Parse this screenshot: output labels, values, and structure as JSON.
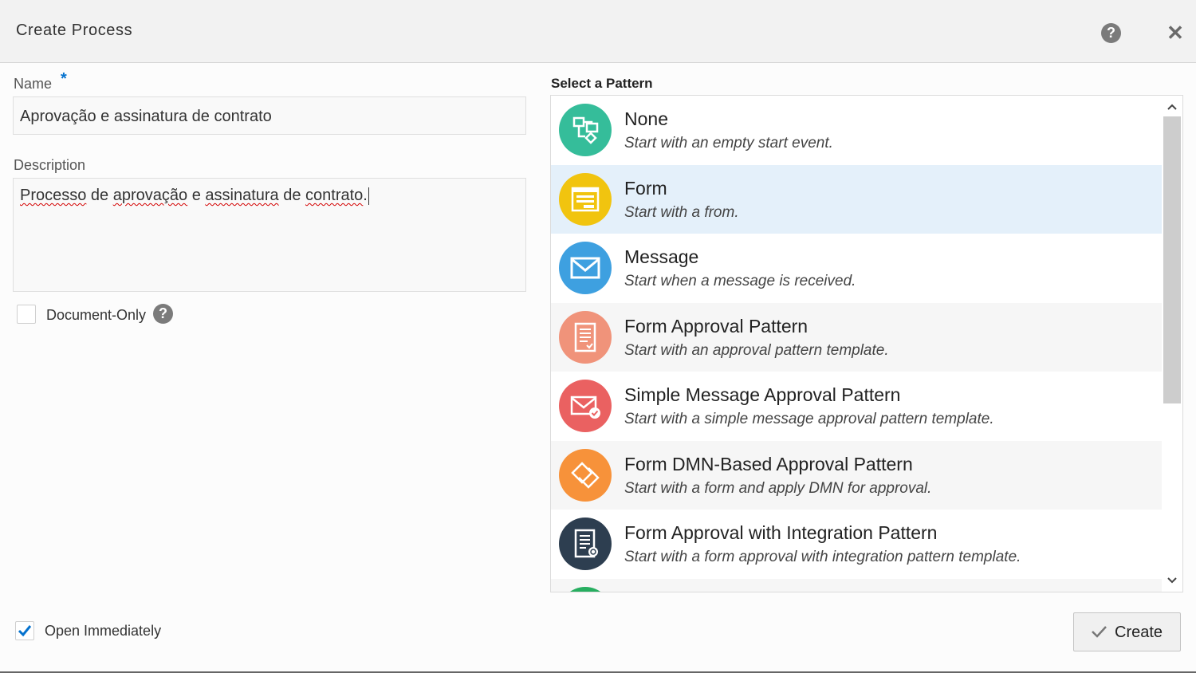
{
  "dialog": {
    "title": "Create Process",
    "help_icon": "question-circle-icon",
    "close_icon": "close-icon",
    "help_glyph": "?",
    "close_glyph": "✕"
  },
  "form": {
    "name_label": "Name",
    "required_marker": "*",
    "name_value": "Aprovação e assinatura de contrato",
    "description_label": "Description",
    "description_words": [
      "Processo",
      " de ",
      "aprovação",
      " e ",
      "assinatura",
      " de ",
      "contrato",
      "."
    ],
    "document_only_label": "Document-Only",
    "document_only_checked": false,
    "open_immediately_label": "Open Immediately",
    "open_immediately_checked": true
  },
  "patterns": {
    "title": "Select a Pattern",
    "selected_index": 1,
    "items": [
      {
        "name": "None",
        "description": "Start with an empty start event.",
        "icon": "flow-diagram-icon",
        "color": "#35bd9a"
      },
      {
        "name": "Form",
        "description": "Start with a from.",
        "icon": "form-icon",
        "color": "#f1c40f"
      },
      {
        "name": "Message",
        "description": "Start when a message is received.",
        "icon": "envelope-icon",
        "color": "#3ea0e0"
      },
      {
        "name": "Form Approval Pattern",
        "description": "Start with an approval pattern template.",
        "icon": "checklist-form-icon",
        "color": "#f0937a"
      },
      {
        "name": "Simple Message Approval Pattern",
        "description": "Start with a simple message approval pattern template.",
        "icon": "envelope-check-icon",
        "color": "#ea6161"
      },
      {
        "name": "Form DMN-Based Approval Pattern",
        "description": "Start with a form and apply DMN for approval.",
        "icon": "decision-diamond-icon",
        "color": "#f7923a"
      },
      {
        "name": "Form Approval with Integration Pattern",
        "description": "Start with a form approval with integration pattern template.",
        "icon": "form-gear-icon",
        "color": "#2d3e50"
      },
      {
        "name": "",
        "description": "",
        "icon": "partially-visible-icon",
        "color": "#27ae60"
      }
    ],
    "row_colors": {
      "default": "#ffffff",
      "alternate": "#f6f6f6",
      "selected": "#e4f0fa"
    }
  },
  "footer": {
    "create_label": "Create",
    "create_icon": "checkmark-icon",
    "create_glyph": "✓"
  },
  "colors": {
    "accent": "#0572ce",
    "spellcheck_underline": "#d40000"
  }
}
